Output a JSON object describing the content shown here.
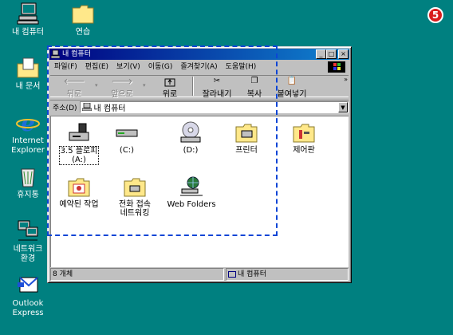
{
  "desktop": {
    "icons": [
      {
        "label": "내 컴퓨터",
        "icon": "my-computer-icon"
      },
      {
        "label": "연습",
        "icon": "folder-icon"
      },
      {
        "label": "내 문서",
        "icon": "my-documents-icon"
      },
      {
        "label": "Internet\nExplorer",
        "icon": "internet-explorer-icon"
      },
      {
        "label": "휴지통",
        "icon": "recycle-bin-icon"
      },
      {
        "label": "네트워크\n환경",
        "icon": "network-neighborhood-icon"
      },
      {
        "label": "Outlook\nExpress",
        "icon": "outlook-express-icon"
      }
    ],
    "step_badge": "5"
  },
  "window": {
    "title": "내 컴퓨터",
    "title_buttons": {
      "minimize": "_",
      "maximize": "□",
      "close": "×"
    },
    "menu": [
      "파일(F)",
      "편집(E)",
      "보기(V)",
      "이동(G)",
      "즐겨찾기(A)",
      "도움말(H)"
    ],
    "toolbar": {
      "back": "뒤로",
      "forward": "앞으로",
      "up": "위로",
      "cut": "잘라내기",
      "copy": "복사",
      "paste": "붙여넣기",
      "more": "»"
    },
    "address": {
      "label": "주소(D)",
      "value": "내 컴퓨터"
    },
    "items": [
      {
        "label": "3.5 플로피\n(A:)",
        "icon": "floppy-drive-icon"
      },
      {
        "label": "(C:)",
        "icon": "hard-drive-icon"
      },
      {
        "label": "(D:)",
        "icon": "cd-drive-icon"
      },
      {
        "label": "프린터",
        "icon": "printers-folder-icon"
      },
      {
        "label": "제어판",
        "icon": "control-panel-icon"
      },
      {
        "label": "예약된 작업",
        "icon": "scheduled-tasks-icon"
      },
      {
        "label": "전화 접속\n네트워킹",
        "icon": "dial-up-networking-icon"
      },
      {
        "label": "Web Folders",
        "icon": "web-folders-icon"
      }
    ],
    "status": {
      "count": "8 개체",
      "location": "내 컴퓨터"
    }
  },
  "colors": {
    "desktop": "#008080",
    "titlebar_start": "#000080",
    "titlebar_end": "#1084d0",
    "selection_border": "#0b45d6",
    "badge": "#d81e1e"
  }
}
